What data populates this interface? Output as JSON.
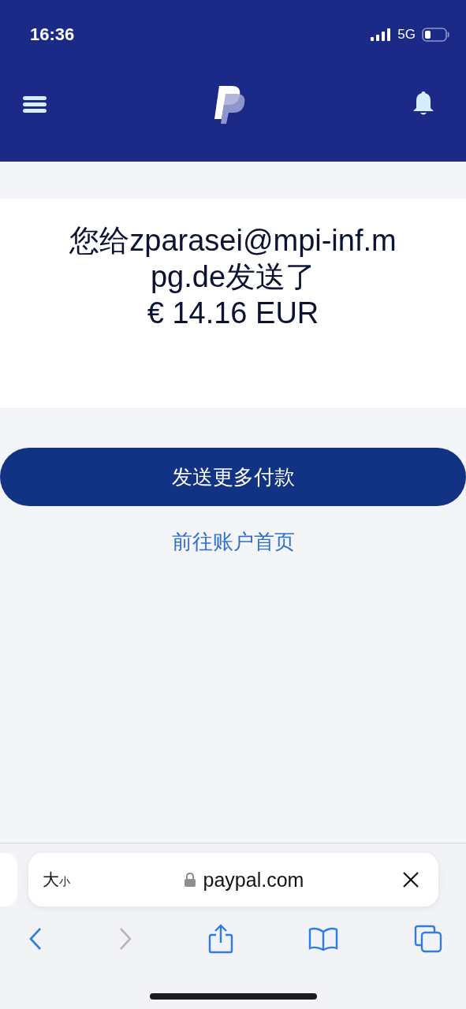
{
  "status_bar": {
    "time": "16:36",
    "network": "5G"
  },
  "message": {
    "text": "您给zparasei@mpi-inf.mpg.de发送了",
    "amount": "€ 14.16 EUR"
  },
  "primary_button": "发送更多付款",
  "link": "前往账户首页",
  "address_bar": {
    "text_size_big": "大",
    "text_size_small": "小",
    "url": "paypal.com"
  },
  "nav_buttons": [
    {
      "kind": "back",
      "disabled": false
    },
    {
      "kind": "forward",
      "disabled": true
    },
    {
      "kind": "share",
      "disabled": false
    },
    {
      "kind": "bookmarks",
      "disabled": false
    },
    {
      "kind": "tabs",
      "disabled": false
    }
  ]
}
